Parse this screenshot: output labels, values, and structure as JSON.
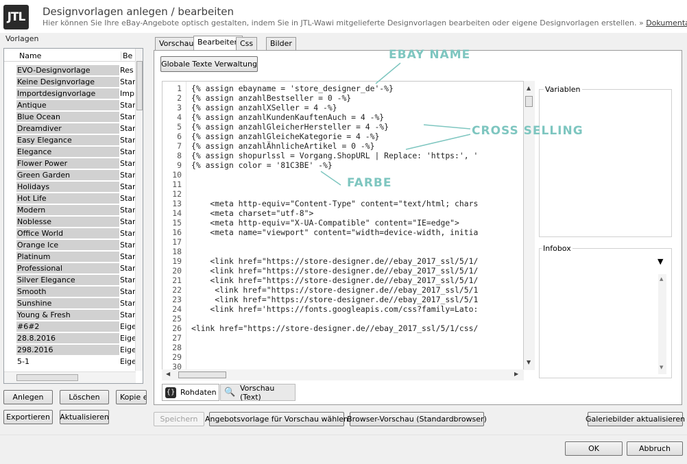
{
  "header": {
    "logo_text": "JTL",
    "title": "Designvorlagen anlegen / bearbeiten",
    "subtitle": "Hier können Sie Ihre eBay-Angebote optisch gestalten, indem Sie in JTL-Wawi mitgelieferte Designvorlagen bearbeiten oder eigene Designvorlagen erstellen. »",
    "doc_link": "Dokumentation"
  },
  "left": {
    "label": "Vorlagen",
    "columns": [
      "Name",
      "Be"
    ],
    "rows": [
      {
        "name": "EVO-Designvorlage",
        "type": "Res"
      },
      {
        "name": "Keine Designvorlage",
        "type": "Stan"
      },
      {
        "name": "Importdesignvorlage",
        "type": "Imp"
      },
      {
        "name": "Antique",
        "type": "Stan"
      },
      {
        "name": "Blue Ocean",
        "type": "Stan"
      },
      {
        "name": "Dreamdiver",
        "type": "Stan"
      },
      {
        "name": "Easy Elegance",
        "type": "Stan"
      },
      {
        "name": "Elegance",
        "type": "Stan"
      },
      {
        "name": "Flower Power",
        "type": "Stan"
      },
      {
        "name": "Green Garden",
        "type": "Stan"
      },
      {
        "name": "Holidays",
        "type": "Stan"
      },
      {
        "name": "Hot Life",
        "type": "Stan"
      },
      {
        "name": "Modern",
        "type": "Stan"
      },
      {
        "name": "Noblesse",
        "type": "Stan"
      },
      {
        "name": "Office World",
        "type": "Stan"
      },
      {
        "name": "Orange Ice",
        "type": "Stan"
      },
      {
        "name": "Platinum",
        "type": "Stan"
      },
      {
        "name": "Professional",
        "type": "Stan"
      },
      {
        "name": "Silver Elegance",
        "type": "Stan"
      },
      {
        "name": "Smooth",
        "type": "Stan"
      },
      {
        "name": "Sunshine",
        "type": "Stan"
      },
      {
        "name": "Young & Fresh",
        "type": "Stan"
      },
      {
        "name": "#6#2",
        "type": "Eige"
      },
      {
        "name": "28.8.2016",
        "type": "Eige"
      },
      {
        "name": "298.2016",
        "type": "Eige"
      },
      {
        "name": "5-1",
        "type": "Eige"
      }
    ],
    "buttons": {
      "add": "Anlegen",
      "delete": "Löschen",
      "copy": "Kopie e",
      "export": "Exportieren",
      "refresh": "Aktualisieren"
    }
  },
  "tabs": [
    "Vorschau",
    "Bearbeiten",
    "Css",
    "Bilder"
  ],
  "toolbar": {
    "global_texts": "Globale Texte Verwaltung"
  },
  "editor": {
    "lines": [
      {
        "n": "1",
        "code": "{% assign ebayname = 'store_designer_de'-%}"
      },
      {
        "n": "2",
        "code": "{% assign anzahlBestseller = 0 -%}"
      },
      {
        "n": "3",
        "code": "{% assign anzahlXSeller = 4 -%}"
      },
      {
        "n": "4",
        "code": "{% assign anzahlKundenKauftenAuch = 4 -%}"
      },
      {
        "n": "5",
        "code": "{% assign anzahlGleicherHersteller = 4 -%}"
      },
      {
        "n": "6",
        "code": "{% assign anzahlGleicheKategorie = 4 -%}"
      },
      {
        "n": "7",
        "code": "{% assign anzahlÄhnlicheArtikel = 0 -%}"
      },
      {
        "n": "8",
        "code": "{% assign shopurlssl = Vorgang.ShopURL | Replace: 'https:', '"
      },
      {
        "n": "9",
        "code": "{% assign color = '81C3BE' -%}"
      },
      {
        "n": "10",
        "code": ""
      },
      {
        "n": "11",
        "code": ""
      },
      {
        "n": "12",
        "code": ""
      },
      {
        "n": "13",
        "code": "    <meta http-equiv=\"Content-Type\" content=\"text/html; chars"
      },
      {
        "n": "14",
        "code": "    <meta charset=\"utf-8\">"
      },
      {
        "n": "15",
        "code": "    <meta http-equiv=\"X-UA-Compatible\" content=\"IE=edge\">"
      },
      {
        "n": "16",
        "code": "    <meta name=\"viewport\" content=\"width=device-width, initia"
      },
      {
        "n": "17",
        "code": ""
      },
      {
        "n": "18",
        "code": ""
      },
      {
        "n": "19",
        "code": "    <link href=\"https://store-designer.de//ebay_2017_ssl/5/1/"
      },
      {
        "n": "20",
        "code": "    <link href=\"https://store-designer.de//ebay_2017_ssl/5/1/"
      },
      {
        "n": "21",
        "code": "    <link href=\"https://store-designer.de//ebay_2017_ssl/5/1/"
      },
      {
        "n": "22",
        "code": "     <link href=\"https://store-designer.de//ebay_2017_ssl/5/1"
      },
      {
        "n": "23",
        "code": "     <link href=\"https://store-designer.de//ebay_2017_ssl/5/1"
      },
      {
        "n": "24",
        "code": "    <link href='https://fonts.googleapis.com/css?family=Lato:"
      },
      {
        "n": "25",
        "code": ""
      },
      {
        "n": "26",
        "code": "<link href=\"https://store-designer.de//ebay_2017_ssl/5/1/css/"
      },
      {
        "n": "27",
        "code": ""
      },
      {
        "n": "28",
        "code": ""
      },
      {
        "n": "29",
        "code": ""
      },
      {
        "n": "30",
        "code": ""
      }
    ]
  },
  "right": {
    "variables_label": "Variablen",
    "infobox_label": "Infobox"
  },
  "annotations": {
    "ebay_name": "EBAY NAME",
    "cross_selling": "CROSS SELLING",
    "farbe": "FARBE",
    "color": "#7ec6c0"
  },
  "subtabs": {
    "raw": "Rohdaten",
    "preview_text": "Vorschau (Text)"
  },
  "actions": {
    "save": "Speichern",
    "choose_offer": "Angebotsvorlage für Vorschau wählen",
    "browser_preview": "Browser-Vorschau (Standardbrowser)",
    "gallery_refresh": "Galeriebilder aktualisieren"
  },
  "footer": {
    "ok": "OK",
    "cancel": "Abbruch"
  }
}
